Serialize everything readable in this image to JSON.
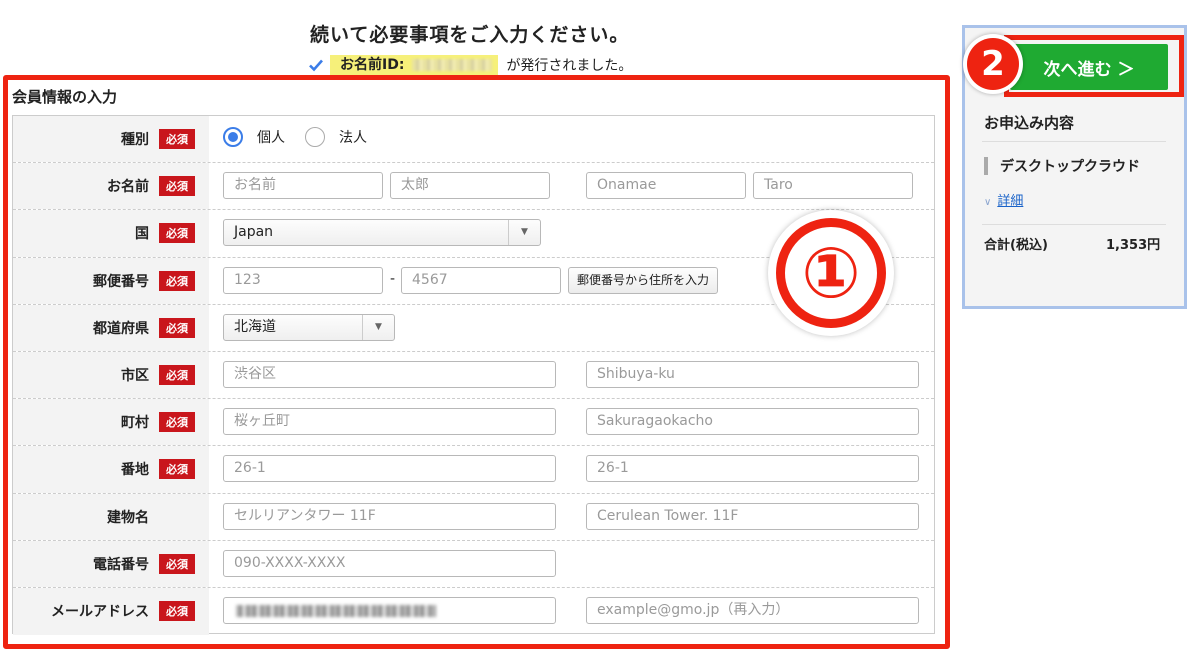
{
  "header": {
    "title": "続いて必要事項をご入力ください。",
    "id_label": "お名前ID:",
    "issued_text": "が発行されました。"
  },
  "form": {
    "section_title": "会員情報の入力",
    "required_label": "必須",
    "type_row": {
      "label": "種別",
      "options": [
        "個人",
        "法人"
      ],
      "selected": "個人"
    },
    "name_row": {
      "label": "お名前",
      "placeholders": [
        "お名前",
        "太郎",
        "Onamae",
        "Taro"
      ]
    },
    "country_row": {
      "label": "国",
      "value": "Japan"
    },
    "zip_row": {
      "label": "郵便番号",
      "placeholders": [
        "123",
        "4567"
      ],
      "separator": "-",
      "button": "郵便番号から住所を入力"
    },
    "prefecture_row": {
      "label": "都道府県",
      "value": "北海道"
    },
    "city_row": {
      "label": "市区",
      "placeholders": [
        "渋谷区",
        "Shibuya-ku"
      ]
    },
    "town_row": {
      "label": "町村",
      "placeholders": [
        "桜ヶ丘町",
        "Sakuragaokacho"
      ]
    },
    "block_row": {
      "label": "番地",
      "placeholders": [
        "26-1",
        "26-1"
      ]
    },
    "building_row": {
      "label": "建物名",
      "placeholders": [
        "セルリアンタワー 11F",
        "Cerulean Tower. 11F"
      ]
    },
    "phone_row": {
      "label": "電話番号",
      "placeholders": [
        "090-XXXX-XXXX"
      ]
    },
    "email_row": {
      "label": "メールアドレス",
      "placeholders": [
        "example@gmo.jp（再入力）"
      ]
    }
  },
  "annotations": {
    "badge_1": "①",
    "badge_2": "2"
  },
  "sidebar": {
    "next_button": "次へ進む ＞",
    "order_title": "お申込み内容",
    "item": "デスクトップクラウド",
    "details_link": "詳細",
    "total_label": "合計(税込)",
    "total_value": "1,353円"
  },
  "colors": {
    "highlight_red": "#ee2311",
    "required_badge": "#c9161c",
    "next_button_green": "#1faa32",
    "sidebar_border": "#a9c2ea",
    "radio_blue": "#3b7de8"
  }
}
